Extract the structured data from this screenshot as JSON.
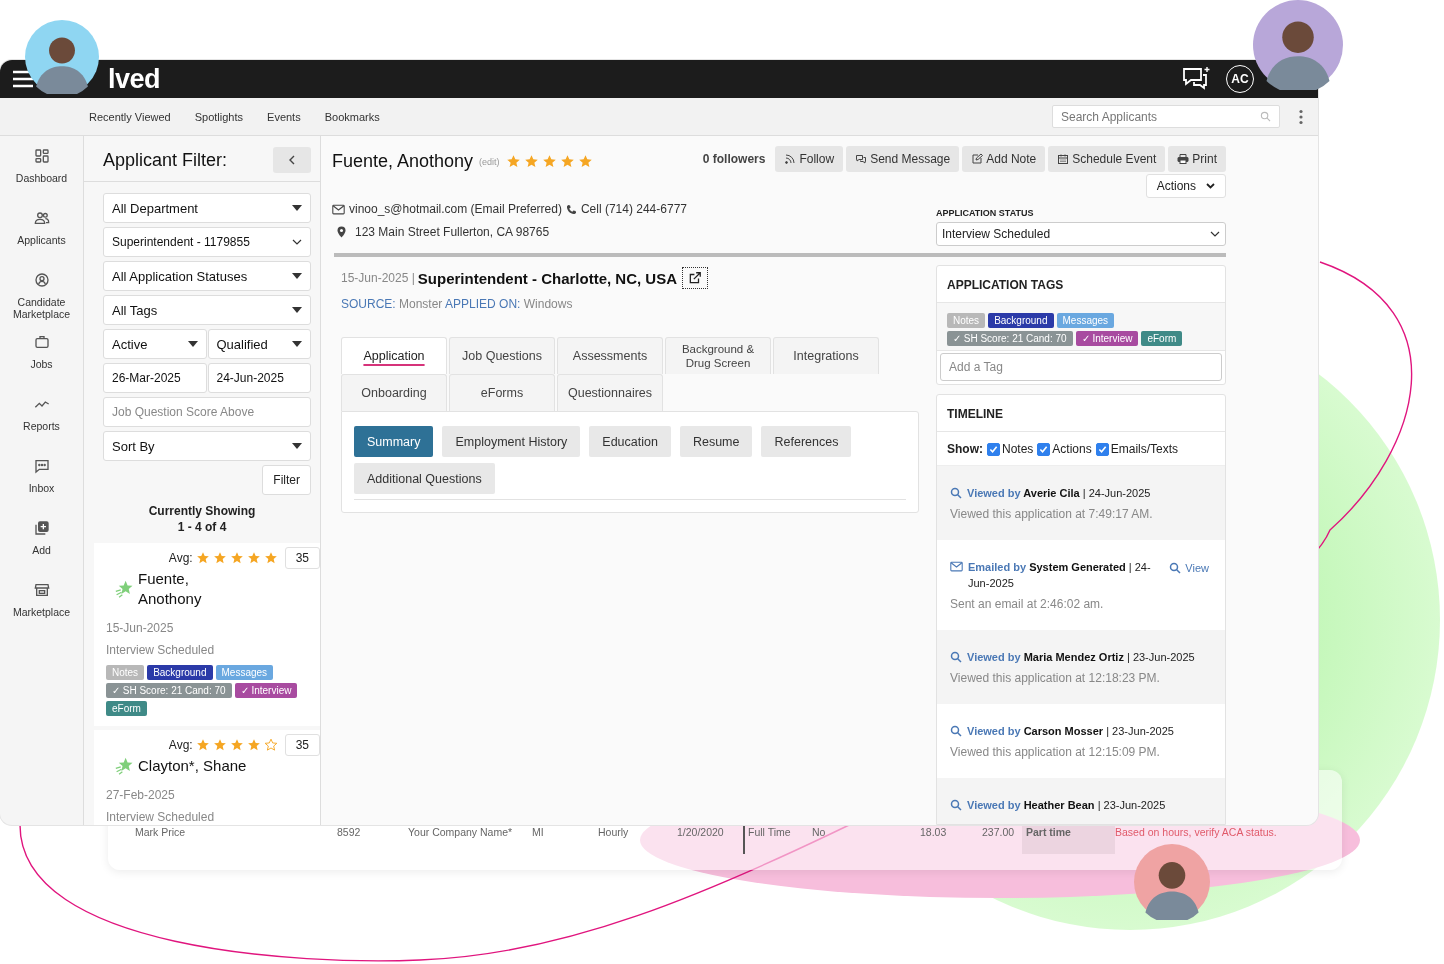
{
  "header": {
    "logo": "lved",
    "initials": "AC"
  },
  "nav": {
    "items": [
      "Recently Viewed",
      "Spotlights",
      "Events",
      "Bookmarks"
    ],
    "search_placeholder": "Search Applicants"
  },
  "sidebar": {
    "items": [
      {
        "label": "Dashboard",
        "kind": "dashboard"
      },
      {
        "label": "Applicants",
        "kind": "applicants"
      },
      {
        "label": "Candidate Marketplace",
        "kind": "candidate"
      },
      {
        "label": "Jobs",
        "kind": "jobs"
      },
      {
        "label": "Reports",
        "kind": "reports"
      },
      {
        "label": "Inbox",
        "kind": "inbox"
      },
      {
        "label": "Add",
        "kind": "add"
      },
      {
        "label": "Marketplace",
        "kind": "marketplace"
      }
    ]
  },
  "filter": {
    "title": "Applicant Filter:",
    "rows": [
      [
        {
          "kind": "select",
          "value": "All Department"
        }
      ],
      [
        {
          "kind": "native",
          "value": "Superintendent - 1179855"
        }
      ],
      [
        {
          "kind": "select",
          "value": "All Application Statuses"
        }
      ],
      [
        {
          "kind": "select",
          "value": "All Tags"
        }
      ],
      [
        {
          "kind": "select",
          "value": "Active"
        },
        {
          "kind": "select",
          "value": "Qualified"
        }
      ],
      [
        {
          "kind": "input",
          "value": "26-Mar-2025"
        },
        {
          "kind": "input",
          "value": "24-Jun-2025"
        }
      ],
      [
        {
          "kind": "input",
          "placeholder": "Job Question Score Above"
        }
      ],
      [
        {
          "kind": "select",
          "value": "Sort By"
        }
      ]
    ],
    "button": "Filter",
    "showing": "Currently Showing",
    "count": "1 - 4 of 4",
    "cards": [
      {
        "avg": "Avg:",
        "stars": 5,
        "score": "35",
        "name": "Fuente, Anothony",
        "date": "15-Jun-2025",
        "status": "Interview Scheduled",
        "tags": [
          {
            "label": "Notes",
            "color": "#b8b8b8"
          },
          {
            "label": "Background",
            "color": "#2b3aa8"
          },
          {
            "label": "Messages",
            "color": "#6aa8e0"
          },
          {
            "label": "✓ SH Score: 21 Cand: 70",
            "color": "#8a9395"
          },
          {
            "label": "✓ Interview",
            "color": "#a84ba0"
          },
          {
            "label": "eForm",
            "color": "#3f8a87"
          }
        ]
      },
      {
        "avg": "Avg:",
        "stars": 4,
        "score": "35",
        "name": "Clayton*, Shane",
        "date": "27-Feb-2025",
        "status": "Interview Scheduled"
      }
    ]
  },
  "applicant": {
    "name": "Fuente, Anothony",
    "edit": "(edit)",
    "stars": 5,
    "followers": "0 followers",
    "buttons": [
      {
        "label": "Follow",
        "kind": "rss"
      },
      {
        "label": "Send Message",
        "kind": "message"
      },
      {
        "label": "Add Note",
        "kind": "note"
      },
      {
        "label": "Schedule Event",
        "kind": "calendar"
      },
      {
        "label": "Print",
        "kind": "print"
      }
    ],
    "actions": "Actions",
    "email": "vinoo_s@hotmail.com (Email Preferred)",
    "phone": "Cell (714) 244-6777",
    "address": "123 Main Street Fullerton, CA 98765",
    "status_label": "APPLICATION STATUS",
    "status": "Interview Scheduled"
  },
  "application": {
    "date": "15-Jun-2025 |",
    "title": "Superintendent - Charlotte, NC, USA",
    "source_label": "SOURCE:",
    "source": "Monster",
    "applied_label": "APPLIED ON:",
    "applied": "Windows",
    "tabs": [
      [
        {
          "label": "Application",
          "selected": true
        },
        {
          "label": "Job Questions",
          "selected": false
        },
        {
          "label": "Assessments",
          "selected": false
        },
        {
          "label": "Background & Drug Screen",
          "selected": false
        },
        {
          "label": "Integrations",
          "selected": false
        }
      ],
      [
        {
          "label": "Onboarding",
          "selected": false
        },
        {
          "label": "eForms",
          "selected": false
        },
        {
          "label": "Questionnaires",
          "selected": false
        }
      ]
    ],
    "subtabs": [
      {
        "label": "Summary",
        "selected": true
      },
      {
        "label": "Employment History",
        "selected": false
      },
      {
        "label": "Education",
        "selected": false
      },
      {
        "label": "Resume",
        "selected": false
      },
      {
        "label": "References",
        "selected": false
      },
      {
        "label": "Additional Questions",
        "selected": false
      }
    ]
  },
  "tags_panel": {
    "title": "APPLICATION TAGS",
    "tags": [
      {
        "label": "Notes",
        "color": "#b8b8b8"
      },
      {
        "label": "Background",
        "color": "#2b3aa8"
      },
      {
        "label": "Messages",
        "color": "#6aa8e0"
      },
      {
        "label": "✓ SH Score: 21 Cand: 70",
        "color": "#8a9395"
      },
      {
        "label": "✓ Interview",
        "color": "#a84ba0"
      },
      {
        "label": "eForm",
        "color": "#3f8a87"
      }
    ],
    "placeholder": "Add a Tag"
  },
  "timeline": {
    "title": "TIMELINE",
    "show_label": "Show:",
    "filters": [
      {
        "label": "Notes",
        "checked": true
      },
      {
        "label": "Actions",
        "checked": true
      },
      {
        "label": "Emails/Texts",
        "checked": true
      }
    ],
    "entries": [
      {
        "kind": "view",
        "action": "Viewed by",
        "who": "Averie Cila",
        "date": "| 24-Jun-2025",
        "detail": "Viewed this application at 7:49:17 AM."
      },
      {
        "kind": "email",
        "action": "Emailed by",
        "who": "System Generated",
        "date": "| 24-Jun-2025",
        "detail": "Sent an email at 2:46:02 am.",
        "link": "View"
      },
      {
        "kind": "view",
        "action": "Viewed by",
        "who": "Maria Mendez Ortiz",
        "date": "| 23-Jun-2025",
        "detail": "Viewed this application at 12:18:23 PM."
      },
      {
        "kind": "view",
        "action": "Viewed by",
        "who": "Carson Mosser",
        "date": "| 23-Jun-2025",
        "detail": "Viewed this application at 12:15:09 PM."
      },
      {
        "kind": "view",
        "action": "Viewed by",
        "who": "Heather Bean",
        "date": "| 23-Jun-2025"
      }
    ]
  },
  "background_window": {
    "cells": [
      {
        "text": "Mark Price",
        "kind": "plain"
      },
      {
        "text": "8592",
        "kind": "plain"
      },
      {
        "text": "Your Company Name*",
        "kind": "plain"
      },
      {
        "text": "MI",
        "kind": "plain"
      },
      {
        "text": "Hourly",
        "kind": "plain"
      },
      {
        "text": "1/20/2020",
        "kind": "plain"
      },
      {
        "text": "Full Time",
        "kind": "divided"
      },
      {
        "text": "No",
        "kind": "plain"
      },
      {
        "text": "18.03",
        "kind": "plain"
      },
      {
        "text": "237.00",
        "kind": "plain"
      },
      {
        "text": "Part time",
        "kind": "shaded"
      },
      {
        "text": "Based on hours, verify ACA status.",
        "kind": "warning"
      }
    ]
  }
}
